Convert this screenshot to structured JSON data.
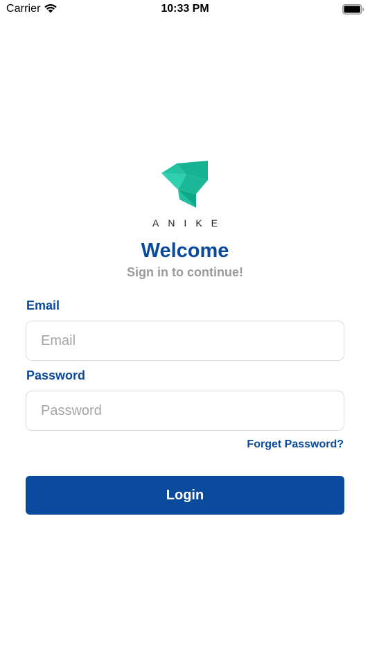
{
  "status_bar": {
    "carrier": "Carrier",
    "time": "10:33 PM",
    "wifi_icon": "wifi-icon",
    "battery_icon": "battery-full-icon"
  },
  "brand": {
    "logo_icon": "anike-bird-logo",
    "name": "ANIKE",
    "logo_color": "#1fbfa0"
  },
  "header": {
    "title": "Welcome",
    "subtitle": "Sign in to continue!"
  },
  "form": {
    "email_label": "Email",
    "email_placeholder": "Email",
    "password_label": "Password",
    "password_placeholder": "Password",
    "forgot_label": "Forget Password?",
    "login_label": "Login"
  },
  "colors": {
    "accent": "#0a4a9c",
    "muted": "#9a9a9a"
  }
}
